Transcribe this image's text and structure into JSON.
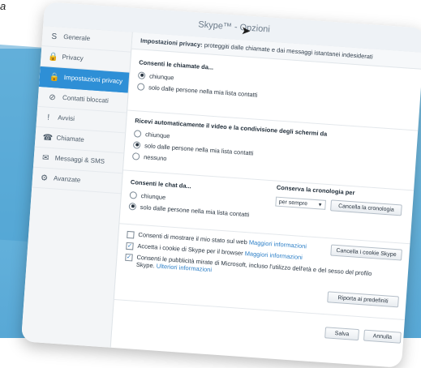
{
  "page_top_text": "a",
  "window": {
    "title": "Skype™ - Opzioni"
  },
  "sidebar": {
    "items": [
      {
        "label": "Generale",
        "icon": "skype-icon"
      },
      {
        "label": "Privacy",
        "icon": "lock-icon"
      },
      {
        "label": "Impostazioni privacy",
        "icon": "lock-icon",
        "selected": true
      },
      {
        "label": "Contatti bloccati",
        "icon": "blocked-icon"
      },
      {
        "label": "Avvisi",
        "icon": "alert-icon"
      },
      {
        "label": "Chiamate",
        "icon": "phone-icon"
      },
      {
        "label": "Messaggi & SMS",
        "icon": "message-icon"
      },
      {
        "label": "Avanzate",
        "icon": "advanced-icon"
      }
    ]
  },
  "header": {
    "bold": "Impostazioni privacy:",
    "text": " proteggiti dalle chiamate e dai messaggi istantanei indesiderati"
  },
  "calls": {
    "title": "Consenti le chiamate da...",
    "options": [
      "chiunque",
      "solo dalle persone nella mia lista contatti"
    ],
    "selected": 0
  },
  "video": {
    "title": "Ricevi automaticamente il video e la condivisione degli schermi da",
    "options": [
      "chiunque",
      "solo dalle persone nella mia lista contatti",
      "nessuno"
    ],
    "selected": 1
  },
  "chat": {
    "title": "Consenti le chat da...",
    "options": [
      "chiunque",
      "solo dalle persone nella mia lista contatti"
    ],
    "selected": 1
  },
  "history": {
    "title": "Conserva la cronologia per",
    "value": "per sempre",
    "clear_button": "Cancella la cronologia"
  },
  "checkboxes": [
    {
      "text": "Consenti di mostrare il mio stato sul web",
      "link": "Maggiori informazioni",
      "checked": false
    },
    {
      "text": "Accetta i cookie di Skype per il browser",
      "link": "Maggiori informazioni",
      "checked": true
    },
    {
      "text": "Consenti le pubblicità mirate di Microsoft, incluso l'utilizzo dell'età e del sesso del profilo Skype.",
      "link": "Ulteriori informazioni",
      "checked": true
    }
  ],
  "buttons": {
    "clear_cookies": "Cancella i cookie Skype",
    "reset_defaults": "Riporta ai predefiniti",
    "save": "Salva",
    "cancel": "Annulla"
  }
}
